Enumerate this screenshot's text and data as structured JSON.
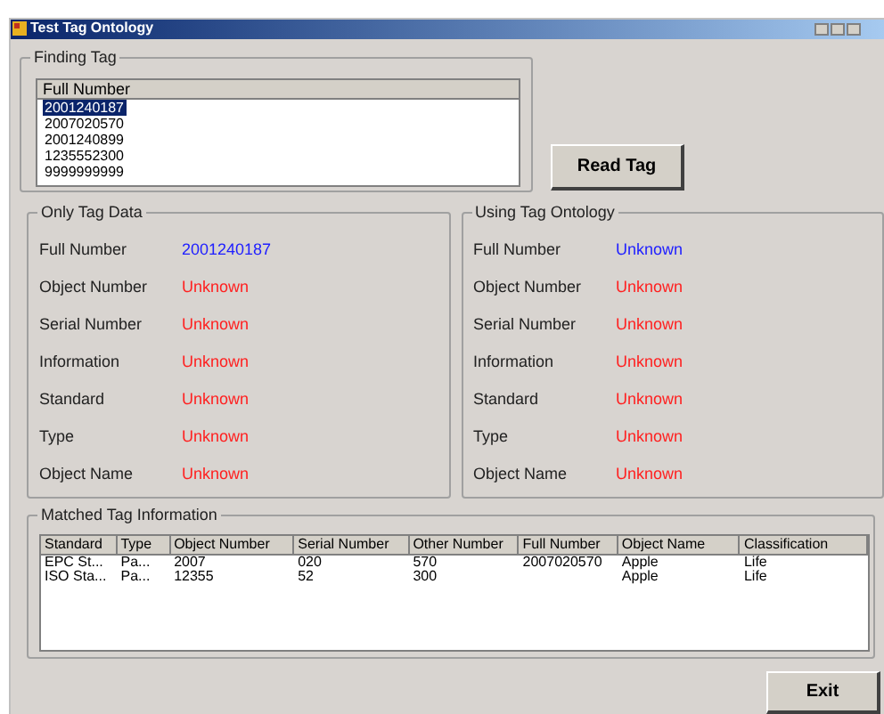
{
  "window": {
    "title": "Test Tag Ontology"
  },
  "finding_tag": {
    "title": "Finding Tag",
    "column": "Full Number",
    "items": [
      {
        "text": "2001240187",
        "selected": true
      },
      {
        "text": "2007020570",
        "selected": false
      },
      {
        "text": "2001240899",
        "selected": false
      },
      {
        "text": "1235552300",
        "selected": false
      },
      {
        "text": "9999999999",
        "selected": false
      }
    ]
  },
  "read_tag_button": "Read Tag",
  "panels": [
    {
      "title": "Only Tag Data",
      "fields": [
        {
          "label": "Full Number",
          "value": "2001240187",
          "color": "#2020ff"
        },
        {
          "label": "Object Number",
          "value": "Unknown",
          "color": "#ff2020"
        },
        {
          "label": "Serial Number",
          "value": "Unknown",
          "color": "#ff2020"
        },
        {
          "label": "Information",
          "value": "Unknown",
          "color": "#ff2020"
        },
        {
          "label": "Standard",
          "value": "Unknown",
          "color": "#ff2020"
        },
        {
          "label": "Type",
          "value": "Unknown",
          "color": "#ff2020"
        },
        {
          "label": "Object Name",
          "value": "Unknown",
          "color": "#ff2020"
        }
      ]
    },
    {
      "title": "Using Tag Ontology",
      "fields": [
        {
          "label": "Full Number",
          "value": "Unknown",
          "color": "#2020ff"
        },
        {
          "label": "Object Number",
          "value": "Unknown",
          "color": "#ff2020"
        },
        {
          "label": "Serial Number",
          "value": "Unknown",
          "color": "#ff2020"
        },
        {
          "label": "Information",
          "value": "Unknown",
          "color": "#ff2020"
        },
        {
          "label": "Standard",
          "value": "Unknown",
          "color": "#ff2020"
        },
        {
          "label": "Type",
          "value": "Unknown",
          "color": "#ff2020"
        },
        {
          "label": "Object Name",
          "value": "Unknown",
          "color": "#ff2020"
        }
      ]
    }
  ],
  "matched": {
    "title": "Matched Tag Information",
    "columns": [
      "Standard",
      "Type",
      "Object Number",
      "Serial Number",
      "Other Number",
      "Full Number",
      "Object Name",
      "Classification"
    ],
    "rows": [
      [
        "EPC St...",
        "Pa...",
        "2007",
        "020",
        "570",
        "2007020570",
        "Apple",
        "Life"
      ],
      [
        "ISO Sta...",
        "Pa...",
        "12355",
        "52",
        "300",
        null,
        "Apple",
        "Life"
      ]
    ]
  },
  "exit_button": "Exit"
}
